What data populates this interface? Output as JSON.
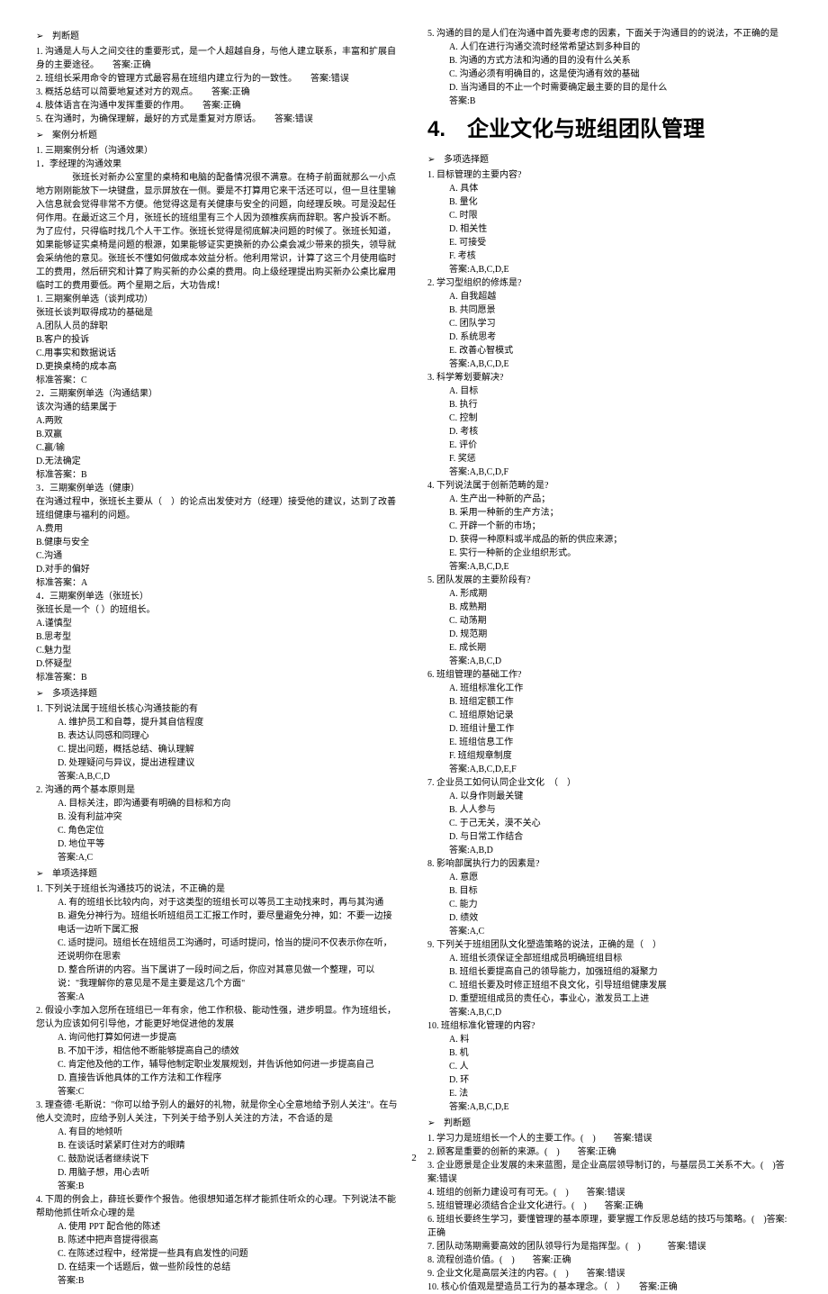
{
  "pageNumber": "2",
  "left": {
    "sec1_header": "判断题",
    "tf": [
      "1. 沟通是人与人之间交往的重要形式，是一个人超越自身，与他人建立联系，丰富和扩展自身的主要途径。　　答案:正确",
      "2. 班组长采用命令的管理方式最容易在班组内建立行为的一致性。　　答案:错误",
      "3. 概括总结可以简要地复述对方的观点。　　答案:正确",
      "4. 肢体语言在沟通中发挥重要的作用。　　答案:正确",
      "5. 在沟通时，为确保理解，最好的方式是重复对方原话。　　答案:错误"
    ],
    "sec2_header": "案例分析题",
    "case_title": "1. 三期案例分析（沟通效果）",
    "case_sub": "1．李经理的沟通效果",
    "case_body": "　　张班长对新办公室里的桌椅和电脑的配备情况很不满意。在椅子前面就那么一小点地方刚刚能放下一块键盘，显示屏放在一侧。要是不打算用它来干活还可以，但一旦往里输入信息就会觉得非常不方便。他觉得这是有关健康与安全的问题，向经理反映。可是没起任何作用。在最近这三个月，张班长的班组里有三个人因为颈椎疾病而辞职。客户投诉不断。为了应付，只得临时找几个人干工作。张班长觉得是彻底解决问题的时候了。张班长知道，如果能够证实桌椅是问题的根源，如果能够证实更换新的办公桌会减少带来的损失，领导就会采纳他的意见。张班长不懂如何做成本效益分析。他利用常识，计算了这三个月使用临时工的费用，然后研究和计算了购买新的办公桌的费用。向上级经理提出购买新办公桌比雇用临时工的费用要低。两个星期之后，大功告成！",
    "cq1": {
      "title": "1. 三期案例单选（谈判成功）",
      "stem": "张班长谈判取得成功的基础是",
      "opts": [
        "A.团队人员的辞职",
        "B.客户的投诉",
        "C.用事实和数据说话",
        "D.更换桌椅的成本高"
      ],
      "ans": "标准答案：C"
    },
    "cq2": {
      "title": "2．三期案例单选（沟通结果）",
      "stem": "该次沟通的结果属于",
      "opts": [
        "A.两败",
        "B.双赢",
        "C.赢/输",
        "D.无法确定"
      ],
      "ans": "标准答案：B"
    },
    "cq3": {
      "title": "3．三期案例单选（健康）",
      "stem": "在沟通过程中，张班长主要从（　）的论点出发使对方（经理）接受他的建议，达到了改善班组健康与福利的问题。",
      "opts": [
        "A.费用",
        "B.健康与安全",
        "C.沟通",
        "D.对手的偏好"
      ],
      "ans": "标准答案：A"
    },
    "cq4": {
      "title": "4．三期案例单选（张班长）",
      "stem": "张班长是一个（ ）的班组长。",
      "opts": [
        "A.谨慎型",
        "B.思考型",
        "C.魅力型",
        "D.怀疑型"
      ],
      "ans": "标准答案：B"
    },
    "sec3_header": "多项选择题",
    "mq1": {
      "stem": "1. 下列说法属于班组长核心沟通技能的有",
      "opts": [
        "A.  维护员工和自尊，提升其自信程度",
        "B.  表达认同感和同理心",
        "C.  提出问题，概括总结、确认理解",
        "D.  处理疑问与异议，提出进程建议"
      ],
      "ans": "答案:A,B,C,D"
    },
    "mq2": {
      "stem": "2. 沟通的两个基本原则是",
      "opts": [
        "A.  目标关注，即沟通要有明确的目标和方向",
        "B.  没有利益冲突",
        "C.  角色定位",
        "D.  地位平等"
      ],
      "ans": "答案:A,C"
    },
    "sec4_header": "单项选择题",
    "sq1": {
      "stem": "1. 下列关于班组长沟通技巧的说法，不正确的是",
      "opts": [
        "A.  有的班组长比较内向，对于这类型的班组长可以等员工主动找来时，再与其沟通",
        "B.  避免分神行为。班组长听班组员工汇报工作时，要尽量避免分神，如：不要一边接电话一边听下属汇报",
        "C.  适时提问。班组长在班组员工沟通时，可适时提问，恰当的提问不仅表示你在听，还说明你在思索",
        "D.  整合所讲的内容。当下属讲了一段时间之后，你应对其意见做一个整理，可以说：\"我理解你的意见是不是主要是这几个方面\""
      ],
      "ans": "答案:A"
    },
    "sq2": {
      "stem": "2. 假设小李加入您所在班组已一年有余，他工作积极、能动性强，进步明显。作为班组长，您认为应该如何引导他，才能更好地促进他的发展",
      "opts": [
        "A.  询问他打算如何进一步提高",
        "B.  不加干涉，相信他不断能够提高自己的绩效",
        "C.  肯定他及他的工作，辅导他制定职业发展规划，并告诉他如何进一步提高自己",
        "D.  直接告诉他具体的工作方法和工作程序"
      ],
      "ans": "答案:C"
    },
    "sq3": {
      "stem": "3. 理查德·毛斯说：\"你可以给予别人的最好的礼物，就是你全心全意地给予别人关注\"。在与他人交流时，应给予别人关注，下列关于给予别人关注的方法，不合适的是",
      "opts": [
        "A.  有目的地倾听",
        "B.  在谈话时紧紧盯住对方的眼睛",
        "C.  鼓励说话者继续说下",
        "D.  用脑子想，用心去听"
      ],
      "ans": "答案:B"
    },
    "sq4": {
      "stem": "4. 下周的例会上，薛班长要作个报告。他很想知道怎样才能抓住听众的心理。下列说法不能帮助他抓住听众心理的是",
      "opts": [
        "A.  使用 PPT 配合他的陈述",
        "B.  陈述中把声音提得很高",
        "C.  在陈述过程中，经常提一些具有启发性的问题",
        "D.  在结束一个话题后，做一些阶段性的总结"
      ],
      "ans": "答案:B"
    }
  },
  "right": {
    "topq": {
      "stem": "5. 沟通的目的是人们在沟通中首先要考虑的因素，下面关于沟通目的的说法，不正确的是",
      "opts": [
        "A.  人们在进行沟通交流时经常希望达到多种目的",
        "B.  沟通的方式方法和沟通的目的没有什么关系",
        "C.  沟通必须有明确目的，这是使沟通有效的基础",
        "D.  当沟通目的不止一个时需要确定最主要的目的是什么"
      ],
      "ans": "答案:B"
    },
    "chapter": "4.　企业文化与班组团队管理",
    "sec_mc": "多项选择题",
    "q1": {
      "stem": "1. 目标管理的主要内容?",
      "opts": [
        "A.  具体",
        "B.  量化",
        "C.  时限",
        "D.  相关性",
        "E.  可接受",
        "F.  考核"
      ],
      "ans": "答案:A,B,C,D,E"
    },
    "q2": {
      "stem": "2. 学习型组织的修炼是?",
      "opts": [
        "A.  自我超越",
        "B.  共同愿景",
        "C.  团队学习",
        "D.  系统思考",
        "E.  改善心智模式"
      ],
      "ans": "答案:A,B,C,D,E"
    },
    "q3": {
      "stem": "3. 科学筹划要解决?",
      "opts": [
        "A.  目标",
        "B.  执行",
        "C.  控制",
        "D.  考核",
        "E.  评价",
        "F.  奖惩"
      ],
      "ans": "答案:A,B,C,D,F"
    },
    "q4": {
      "stem": "4. 下列说法属于创新范畴的是?",
      "opts": [
        "A.  生产出一种新的产品；",
        "B.  采用一种新的生产方法；",
        "C.  开辟一个新的市场；",
        "D.  获得一种原料或半成品的新的供应来源；",
        "E.  实行一种新的企业组织形式。"
      ],
      "ans": "答案:A,B,C,D,E"
    },
    "q5": {
      "stem": "5. 团队发展的主要阶段有?",
      "opts": [
        "A.  形成期",
        "B.  成熟期",
        "C.  动荡期",
        "D.  规范期",
        "E.  成长期"
      ],
      "ans": "答案:A,B,C,D"
    },
    "q6": {
      "stem": "6. 班组管理的基础工作?",
      "opts": [
        "A.  班组标准化工作",
        "B.  班组定额工作",
        "C.  班组原始记录",
        "D.  班组计量工作",
        "E.  班组信息工作",
        "F.  班组规章制度"
      ],
      "ans": "答案:A,B,C,D,E,F"
    },
    "q7": {
      "stem": "7. 企业员工如何认同企业文化　（　）",
      "opts": [
        "A.  以身作则最关键",
        "B.  人人参与",
        "C.  于己无关，漠不关心",
        "D.  与日常工作结合"
      ],
      "ans": "答案:A,B,D"
    },
    "q8": {
      "stem": "8. 影响部属执行力的因素是?",
      "opts": [
        "A.  意愿",
        "B.  目标",
        "C.  能力",
        "D.  绩效"
      ],
      "ans": "答案:A,C"
    },
    "q9": {
      "stem": "9. 下列关于班组团队文化塑造策略的说法，正确的是（　）",
      "opts": [
        "A.  班组长须保证全部班组成员明确班组目标",
        "B.  班组长要提高自己的领导能力，加强班组的凝聚力",
        "C.  班组长要及时修正班组不良文化，引导班组健康发展",
        "D.  重塑班组成员的责任心，事业心，激发员工上进"
      ],
      "ans": "答案:A,B,C,D"
    },
    "q10": {
      "stem": "10. 班组标准化管理的内容?",
      "opts": [
        "A.  料",
        "B.  机",
        "C.  人",
        "D.  环",
        "E.  法"
      ],
      "ans": "答案:A,B,C,D,E"
    },
    "sec_tf": "判断题",
    "tf": [
      "1. 学习力是班组长一个人的主要工作。(　)　　答案:错误",
      "2. 顾客是重要的创新的来源。(　)　　答案:正确",
      "3. 企业愿景是企业发展的未来蓝图，是企业高层领导制订的，与基层员工关系不大。(　)答案:错误",
      "4. 班组的创新力建设可有可无。(　)　　答案:错误",
      "5. 班组管理必须结合企业文化进行。(　)　　答案:正确",
      "6. 班组长要终生学习，要懂管理的基本原理，要掌握工作反思总结的技巧与策略。(　)答案:正确",
      "7. 团队动荡期需要高效的团队领导行为是指挥型。(　)　　　答案:错误",
      "8. 流程创造价值。(　)　　答案:正确",
      "9. 企业文化是高层关注的内容。(　)　　答案:错误",
      "10. 核心价值观是塑造员工行为的基本理念。（　）　　答案:正确"
    ]
  }
}
